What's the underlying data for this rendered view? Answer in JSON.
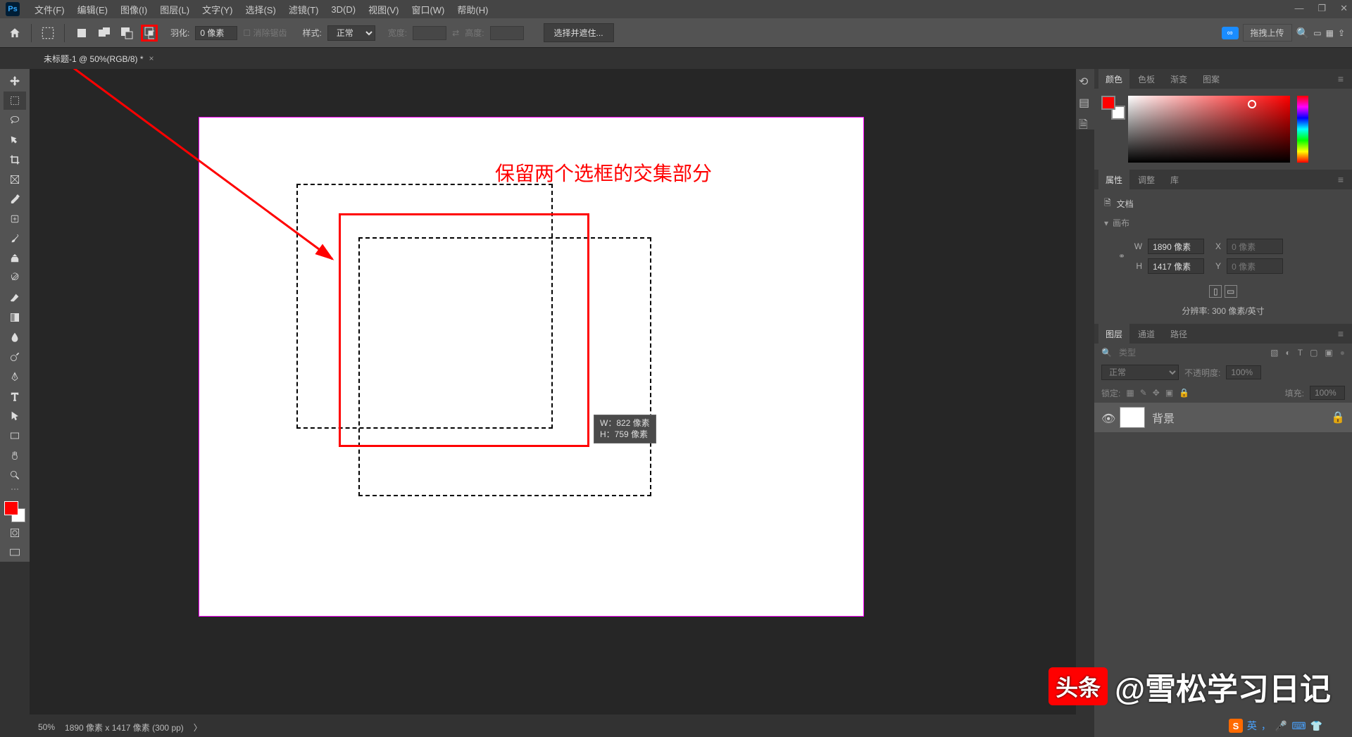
{
  "menubar": {
    "items": [
      "文件(F)",
      "编辑(E)",
      "图像(I)",
      "图层(L)",
      "文字(Y)",
      "选择(S)",
      "滤镜(T)",
      "3D(D)",
      "视图(V)",
      "窗口(W)",
      "帮助(H)"
    ]
  },
  "optbar": {
    "feather_label": "羽化:",
    "feather_value": "0 像素",
    "antialias": "消除锯齿",
    "style_label": "样式:",
    "style_value": "正常",
    "width_label": "宽度:",
    "height_label": "高度:",
    "select_mask": "选择并遮住...",
    "upload": "拖拽上传"
  },
  "doc_tab": "未标题-1 @ 50%(RGB/8) *",
  "canvas": {
    "annotation": "保留两个选框的交集部分",
    "tooltip_w": "W：822 像素",
    "tooltip_h": "H：759 像素"
  },
  "panels": {
    "color_tabs": [
      "颜色",
      "色板",
      "渐变",
      "图案"
    ],
    "prop_tabs": [
      "属性",
      "调整",
      "库"
    ],
    "prop_doc": "文档",
    "prop_canvas": "画布",
    "w_label": "W",
    "w_value": "1890 像素",
    "x_label": "X",
    "x_value": "0 像素",
    "h_label": "H",
    "h_value": "1417 像素",
    "y_label": "Y",
    "y_value": "0 像素",
    "resolution": "分辨率: 300 像素/英寸",
    "layer_tabs": [
      "图层",
      "通道",
      "路径"
    ],
    "layer_kind": "类型",
    "blend_mode": "正常",
    "opacity_label": "不透明度:",
    "opacity_value": "100%",
    "lock_label": "锁定:",
    "fill_label": "填充:",
    "fill_value": "100%",
    "layer_name": "背景"
  },
  "statusbar": {
    "zoom": "50%",
    "info": "1890 像素 x 1417 像素 (300 pp)"
  },
  "watermark": {
    "logo": "头条",
    "text": "@雪松学习日记"
  },
  "ime": {
    "lang": "英"
  }
}
